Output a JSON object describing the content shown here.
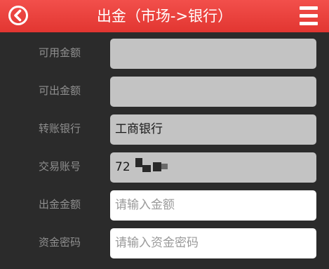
{
  "header": {
    "title": "出金（市场->银行）",
    "back_icon": "back-arrow-circle-icon",
    "menu_icon": "hamburger-menu-icon"
  },
  "form": {
    "available_amount": {
      "label": "可用金额",
      "value": ""
    },
    "withdrawable_amount": {
      "label": "可出金额",
      "value": ""
    },
    "transfer_bank": {
      "label": "转账银行",
      "value": "工商银行"
    },
    "trade_account": {
      "label": "交易账号",
      "value": "72"
    },
    "withdraw_amount": {
      "label": "出金金额",
      "placeholder": "请输入金额",
      "value": ""
    },
    "fund_password": {
      "label": "资金密码",
      "placeholder": "请输入资金密码",
      "value": ""
    }
  },
  "colors": {
    "header": "#e6393a",
    "background": "#2b2b2b",
    "readonly_field": "#c3c3c3",
    "label_text": "#8f8f8f"
  }
}
